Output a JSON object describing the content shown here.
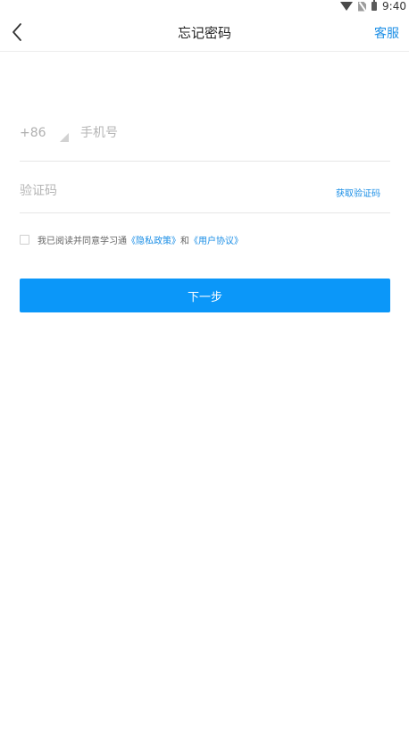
{
  "status_bar": {
    "time": "9:40",
    "icons": [
      "wifi-icon",
      "no-sim-icon",
      "battery-icon"
    ]
  },
  "header": {
    "back_icon": "chevron-left-icon",
    "title": "忘记密码",
    "service_label": "客服"
  },
  "form": {
    "country_code": "+86",
    "phone_placeholder": "手机号",
    "code_placeholder": "验证码",
    "get_code_label": "获取验证码"
  },
  "agreement": {
    "checked": false,
    "prefix": "我已阅读并同意学习通",
    "privacy_link": "《隐私政策》",
    "conjunction": "和",
    "terms_link": "《用户协议》"
  },
  "actions": {
    "next_label": "下一步"
  },
  "colors": {
    "accent": "#0b97f9",
    "link": "#1a8ee6",
    "divider": "#e6e6e6",
    "placeholder": "#b5b5b5"
  }
}
